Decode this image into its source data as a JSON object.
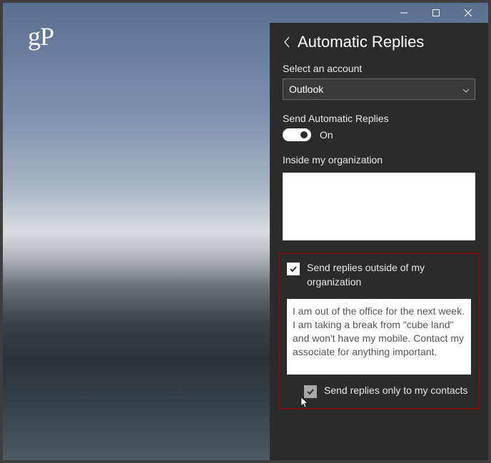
{
  "logo": "gP",
  "titlebar": {
    "minimize_title": "Minimize",
    "maximize_title": "Maximize",
    "close_title": "Close"
  },
  "panel": {
    "title": "Automatic Replies",
    "account_label": "Select an account",
    "account_value": "Outlook",
    "send_label": "Send Automatic Replies",
    "toggle_state": "On",
    "inside_label": "Inside my organization",
    "inside_value": "",
    "outside_check_label": "Send replies outside of my organization",
    "outside_value": "I am out of the office for the next week. I am taking a break from \"cube land\" and won't have my mobile. Contact my associate for anything important.",
    "contacts_check_label": "Send replies only to my contacts"
  }
}
